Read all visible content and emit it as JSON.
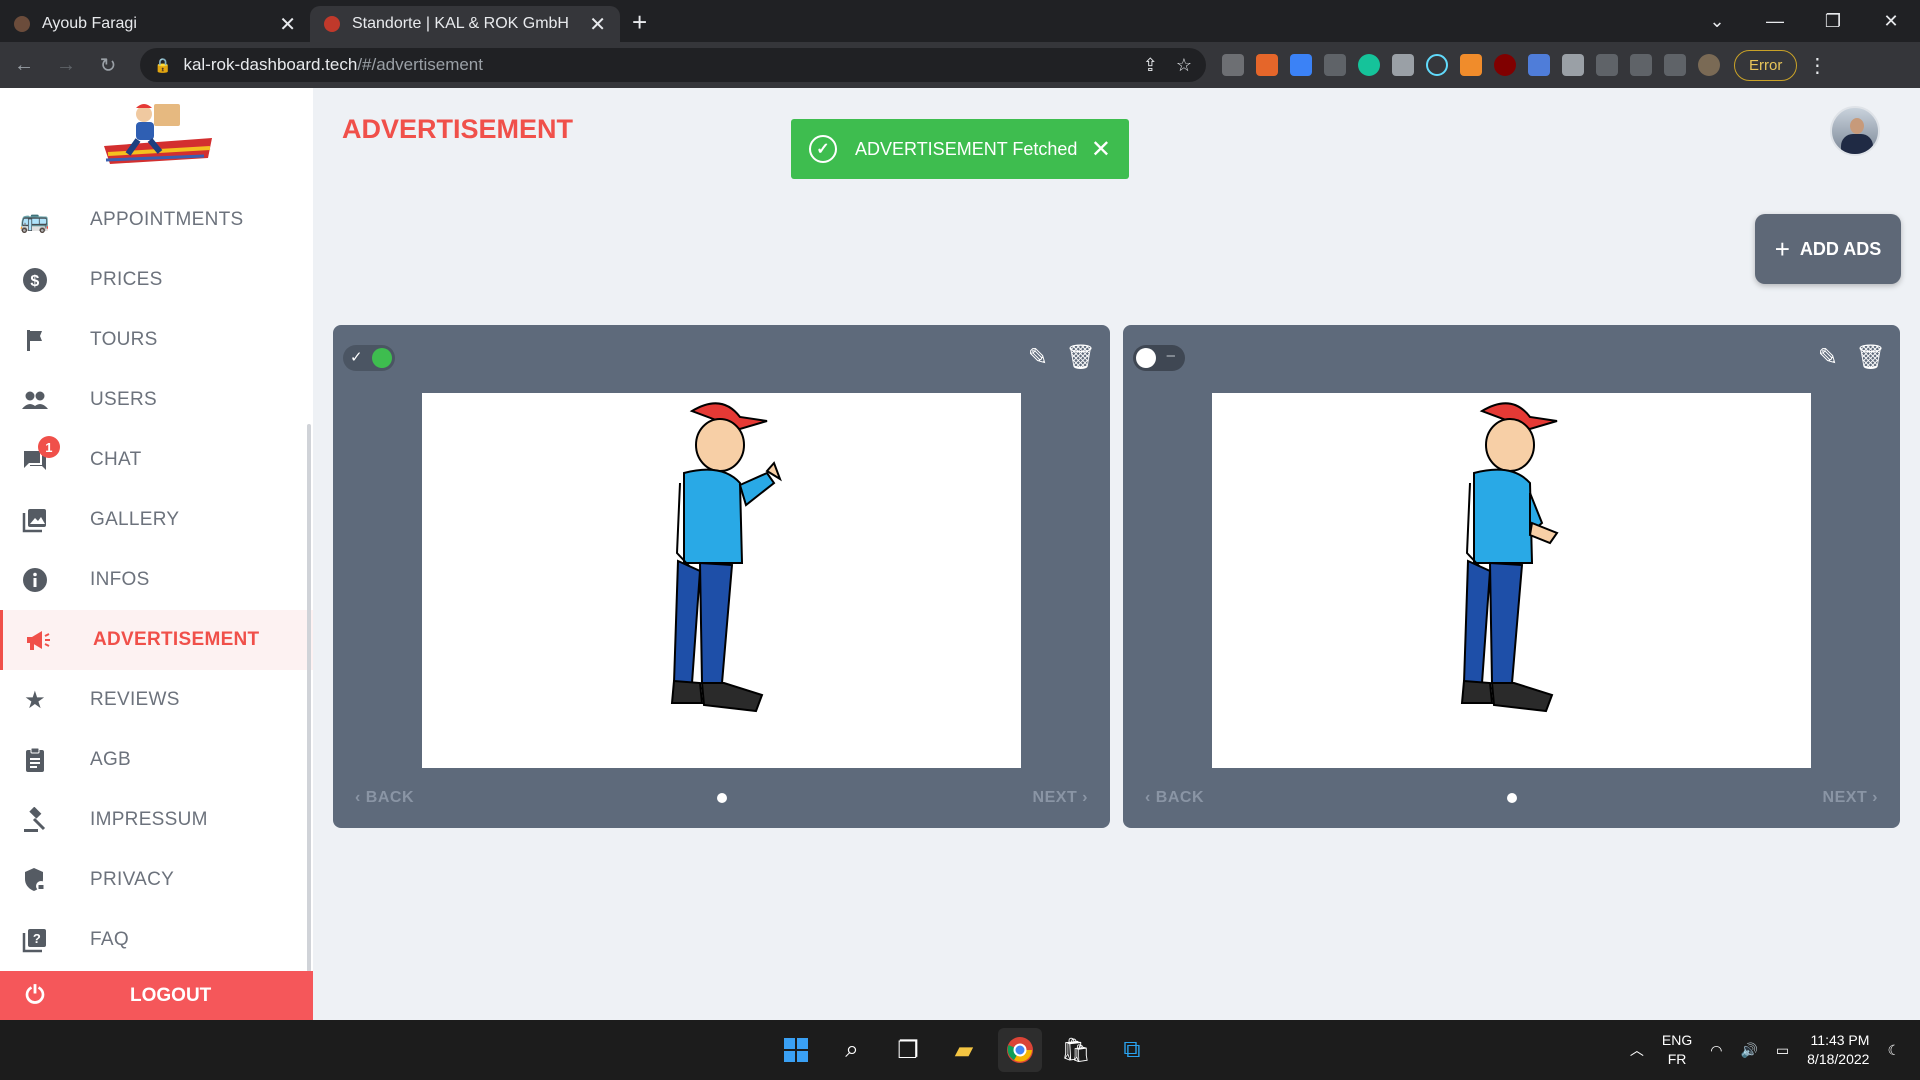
{
  "browser": {
    "tabs": [
      {
        "title": "Ayoub Faragi"
      },
      {
        "title": "Standorte | KAL & ROK GmbH"
      }
    ],
    "url_host": "kal-rok-dashboard.tech",
    "url_path": "/#/advertisement",
    "error_label": "Error"
  },
  "sidebar": {
    "items": [
      {
        "label": "APPOINTMENTS",
        "icon": "bus-clock-icon"
      },
      {
        "label": "PRICES",
        "icon": "dollar-icon"
      },
      {
        "label": "TOURS",
        "icon": "flag-icon"
      },
      {
        "label": "USERS",
        "icon": "users-icon"
      },
      {
        "label": "CHAT",
        "icon": "chat-icon",
        "badge": "1"
      },
      {
        "label": "GALLERY",
        "icon": "gallery-icon"
      },
      {
        "label": "INFOS",
        "icon": "info-icon"
      },
      {
        "label": "ADVERTISEMENT",
        "icon": "megaphone-icon",
        "active": true
      },
      {
        "label": "REVIEWS",
        "icon": "star-icon"
      },
      {
        "label": "AGB",
        "icon": "clipboard-icon"
      },
      {
        "label": "IMPRESSUM",
        "icon": "gavel-icon"
      },
      {
        "label": "PRIVACY",
        "icon": "shield-lock-icon"
      },
      {
        "label": "FAQ",
        "icon": "question-icon"
      }
    ],
    "logout_label": "LOGOUT"
  },
  "main": {
    "title": "ADVERTISEMENT",
    "toast": "ADVERTISEMENT Fetched",
    "add_button": "ADD ADS",
    "cards": [
      {
        "enabled": true,
        "back": "BACK",
        "next": "NEXT"
      },
      {
        "enabled": false,
        "back": "BACK",
        "next": "NEXT"
      }
    ]
  },
  "taskbar": {
    "lang_top": "ENG",
    "lang_bottom": "FR",
    "time": "11:43 PM",
    "date": "8/18/2022"
  },
  "colors": {
    "accent": "#f0504a",
    "toast": "#3ebd4f",
    "card": "#5e6a7b"
  }
}
